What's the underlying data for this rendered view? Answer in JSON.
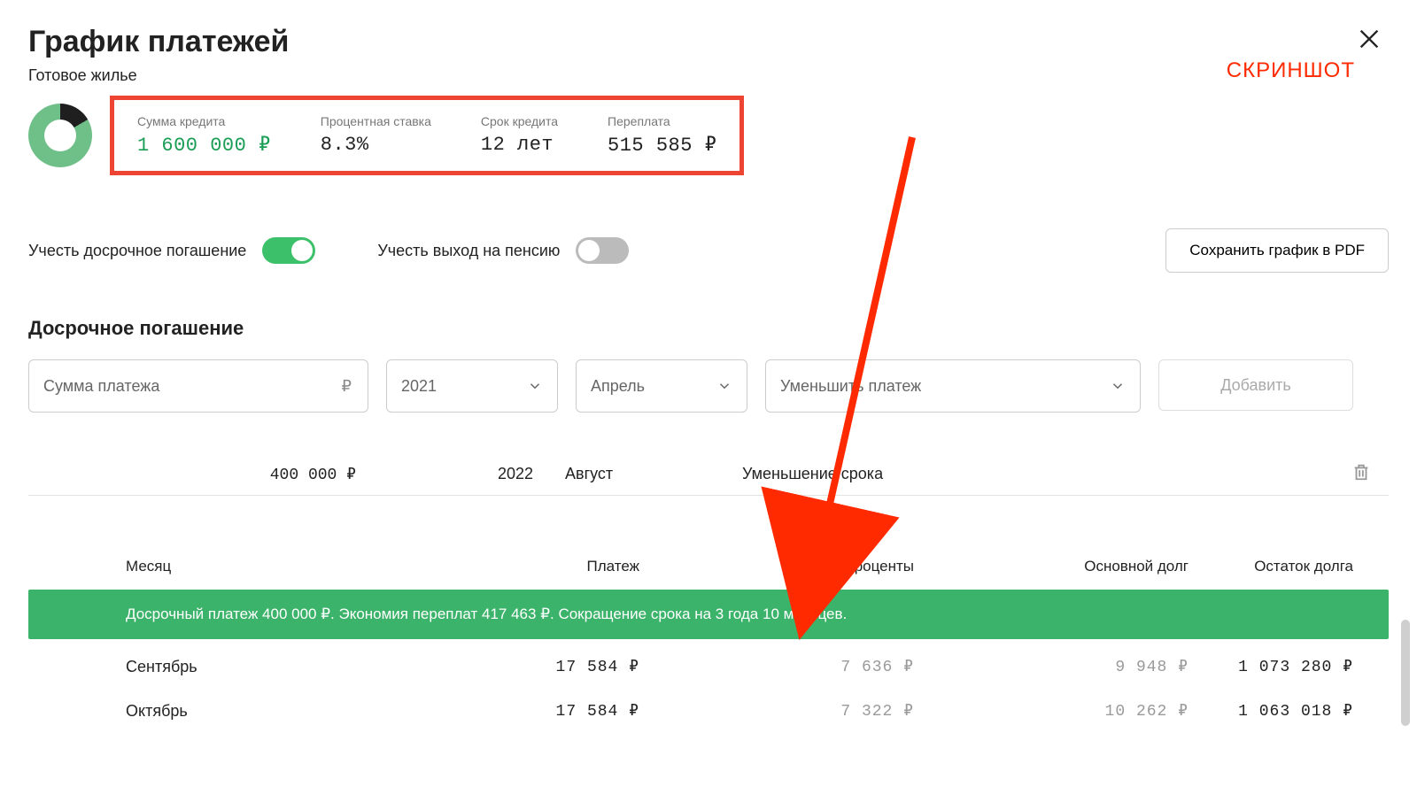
{
  "annotation": {
    "screenshot_label": "СКРИНШОТ"
  },
  "header": {
    "title": "График платежей",
    "subtitle": "Готовое жилье"
  },
  "summary": {
    "donut": {
      "principal_share_deg": 300
    },
    "items": {
      "loan_amount_label": "Сумма кредита",
      "loan_amount_value": "1 600 000 ₽",
      "rate_label": "Процентная ставка",
      "rate_value": "8.3%",
      "term_label": "Срок кредита",
      "term_value": "12 лет",
      "overpay_label": "Переплата",
      "overpay_value": "515 585 ₽"
    }
  },
  "options": {
    "early_repay_label": "Учесть досрочное погашение",
    "early_repay_on": true,
    "retirement_label": "Учесть выход на пенсию",
    "retirement_on": false,
    "save_pdf_label": "Сохранить график в PDF"
  },
  "early_section": {
    "heading": "Досрочное погашение",
    "form": {
      "amount_placeholder": "Сумма платежа",
      "ruble_sign": "₽",
      "year_value": "2021",
      "month_value": "Апрель",
      "type_value": "Уменьшить платеж",
      "add_button": "Добавить"
    },
    "entries": [
      {
        "amount": "400 000 ₽",
        "year": "2022",
        "month": "Август",
        "type": "Уменьшение срока"
      }
    ]
  },
  "table": {
    "headers": {
      "month": "Месяц",
      "payment": "Платеж",
      "interest": "Проценты",
      "principal": "Основной долг",
      "balance": "Остаток долга"
    },
    "banner": "Досрочный платеж 400 000 ₽. Экономия переплат 417 463 ₽. Сокращение срока на 3 года 10 месяцев.",
    "rows": [
      {
        "month": "Сентябрь",
        "payment": "17 584 ₽",
        "interest": "7 636 ₽",
        "principal": "9 948 ₽",
        "balance": "1 073 280 ₽"
      },
      {
        "month": "Октябрь",
        "payment": "17 584 ₽",
        "interest": "7 322 ₽",
        "principal": "10 262 ₽",
        "balance": "1 063 018 ₽"
      }
    ]
  }
}
